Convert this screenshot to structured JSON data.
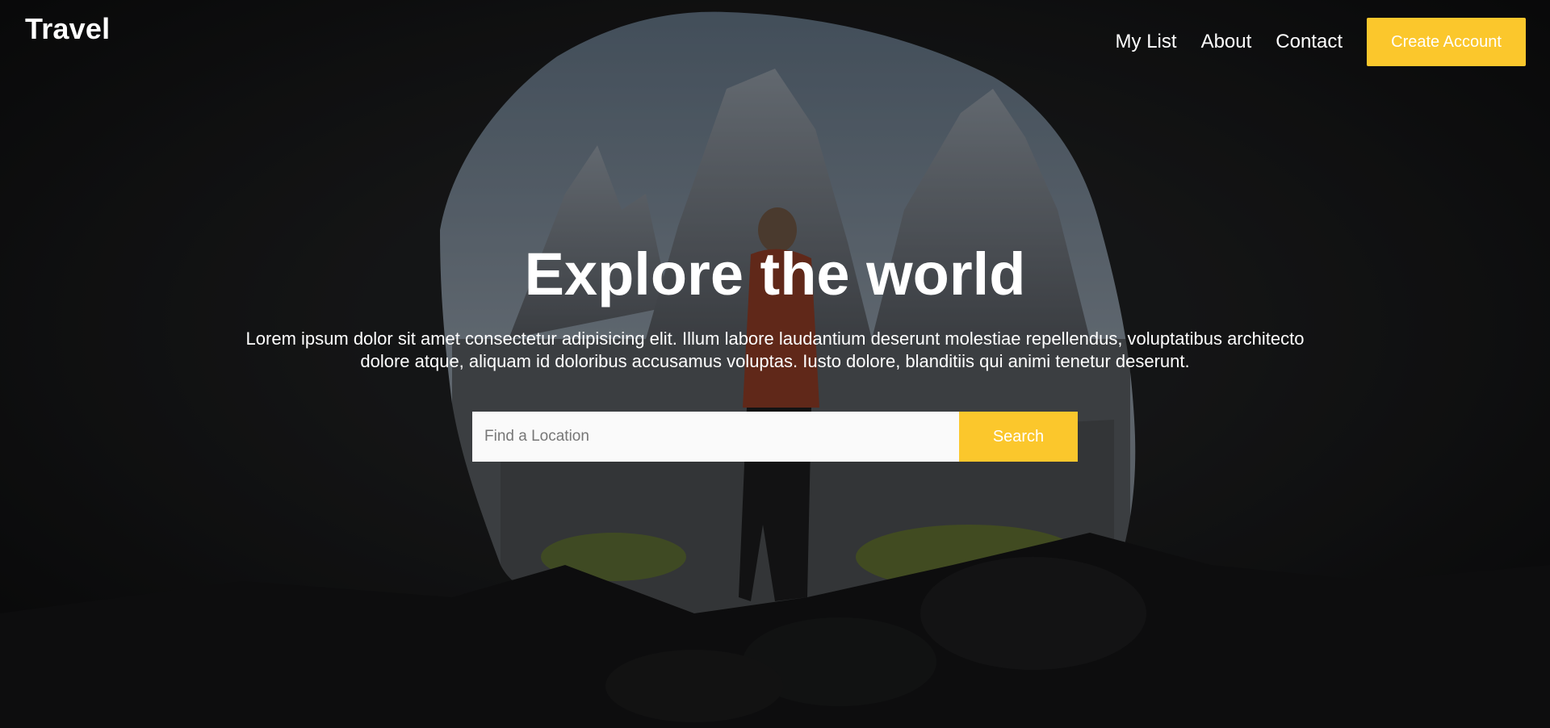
{
  "brand": {
    "name": "Travel"
  },
  "nav": {
    "items": [
      {
        "label": "My List"
      },
      {
        "label": "About"
      },
      {
        "label": "Contact"
      }
    ],
    "cta_label": "Create Account"
  },
  "hero": {
    "title": "Explore the world",
    "description": "Lorem ipsum dolor sit amet consectetur adipisicing elit. Illum labore laudantium deserunt molestiae repellendus, voluptatibus architecto dolore atque, aliquam id doloribus accusamus voluptas. Iusto dolore, blanditiis qui animi tenetur deserunt.",
    "search": {
      "placeholder": "Find a Location",
      "button_label": "Search"
    }
  },
  "colors": {
    "accent": "#fbc72c",
    "text": "#ffffff",
    "input_bg": "#fafafa"
  }
}
